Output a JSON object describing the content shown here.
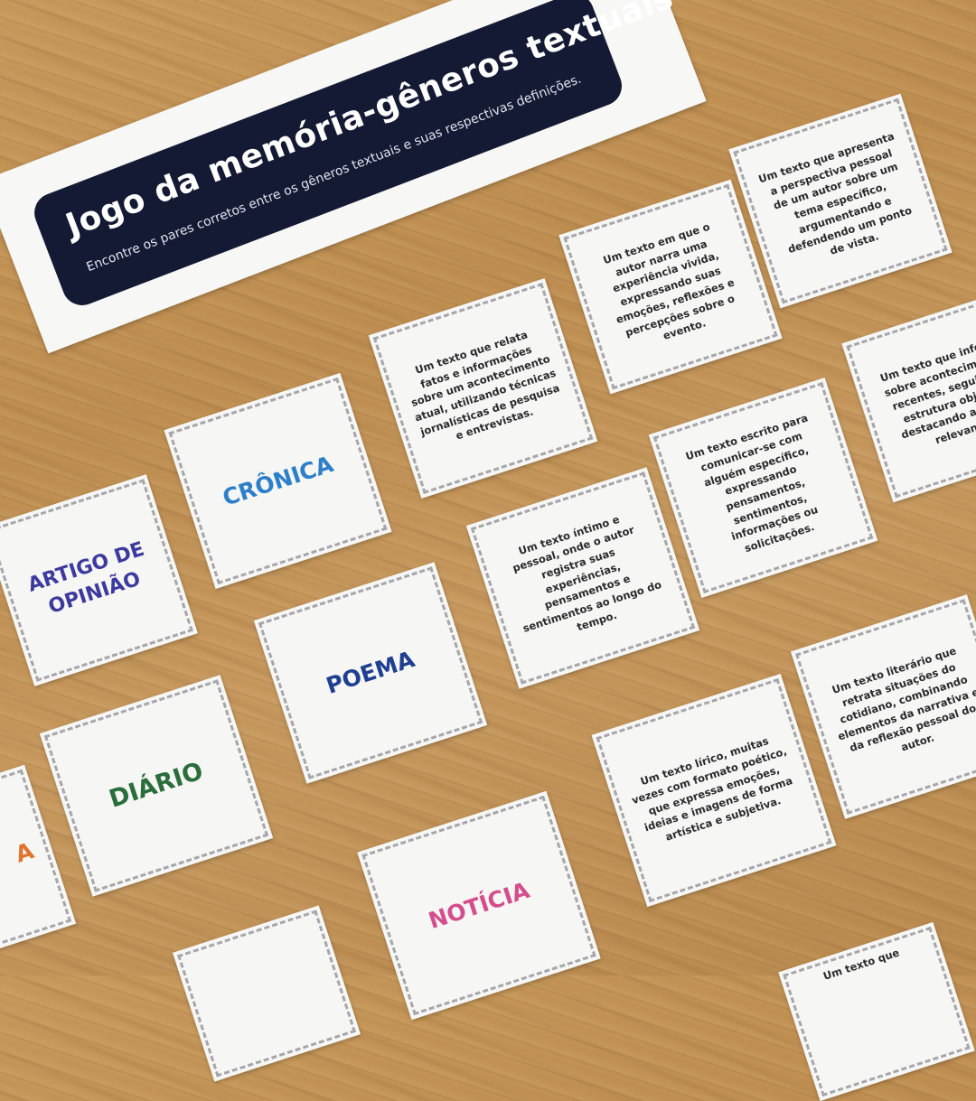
{
  "banner": {
    "title": "Jogo da memória-gêneros textuais",
    "subtitle": "Encontre os pares corretos entre os gêneros textuais e suas respectivas definições."
  },
  "colors": {
    "cronica": "#2e7fc9",
    "artigo": "#3d3a9e",
    "poema": "#1f3f8f",
    "diario": "#2a6e3c",
    "noticia": "#d44d8c",
    "partial": "#e0742e",
    "banner_bg": "#141a33"
  },
  "cards": {
    "cronica": "CRÔNICA",
    "artigo": "ARTIGO DE OPINIÃO",
    "poema": "POEMA",
    "diario": "DIÁRIO",
    "noticia": "NOTÍCIA",
    "partial_left": "A",
    "def_noticia": "Um texto que relata fatos e informações sobre um acontecimento atual, utilizando técnicas jornalísticas de pesquisa e entrevistas.",
    "def_relato": "Um texto em que o autor narra uma experiência vivida, expressando suas emoções, reflexões e percepções sobre o evento.",
    "def_artigo": "Um texto que apresenta a perspectiva pessoal de um autor sobre um tema específico, argumentando e defendendo um ponto de vista.",
    "def_reportagem_partial": "Um texto que informa sobre acontecimentos recentes, seguindo a estrutura objetiva, destacando aspectos relevantes",
    "def_carta": "Um texto escrito para comunicar-se com alguém específico, expressando pensamentos, sentimentos, informações ou solicitações.",
    "def_diario": "Um texto íntimo e pessoal, onde o autor registra suas experiências, pensamentos e sentimentos ao longo do tempo.",
    "def_cronica_partial": "Um texto literário que retrata situações do cotidiano, combinando elementos da narrativa e da reflexão pessoal do autor.",
    "def_poema": "Um texto lírico, muitas vezes com formato poético, que expressa emoções, ideias e imagens de forma artística e subjetiva.",
    "def_bottom_partial": "Um texto que"
  }
}
